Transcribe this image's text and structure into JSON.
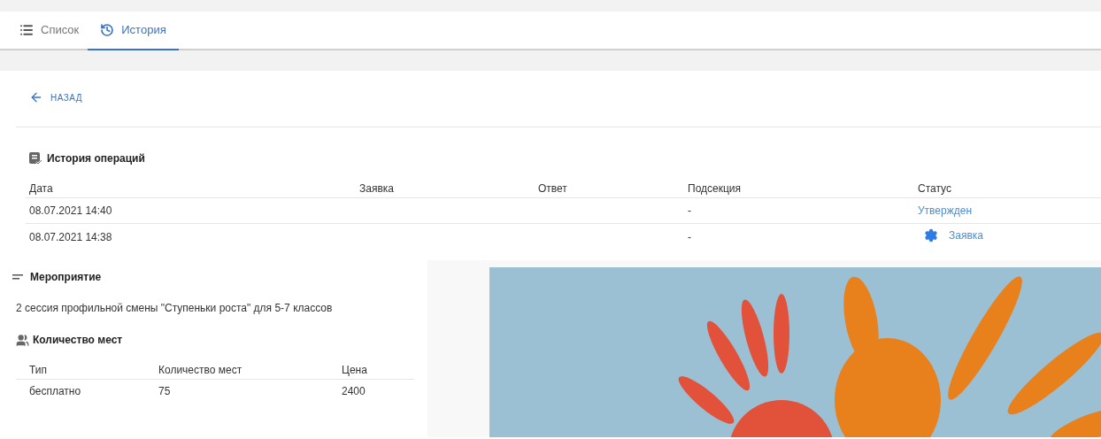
{
  "tabs": [
    {
      "label": "Список",
      "kind": "list",
      "selected": false
    },
    {
      "label": "История",
      "kind": "history",
      "selected": true
    }
  ],
  "back_link": "НАЗАД",
  "history": {
    "title": "История операций",
    "columns": [
      "Дата",
      "Заявка",
      "Ответ",
      "Подсекция",
      "Статус"
    ],
    "rows": [
      {
        "date": "08.07.2021 14:40",
        "subsection": "-",
        "status": {
          "kind": "link",
          "text": "Утвержден"
        }
      },
      {
        "date": "08.07.2021 14:38",
        "subsection": "-",
        "status": {
          "kind": "gear-link",
          "text": "Заявка"
        }
      }
    ]
  },
  "event": {
    "title": "Мероприятие",
    "description": "2 сессия профильной смены \"Ступеньки роста\" для 5-7 классов"
  },
  "places": {
    "title": "Количество мест",
    "columns": [
      "Тип",
      "Количество мест",
      "Цена"
    ],
    "rows": [
      [
        "бесплатно",
        "75",
        "2400"
      ]
    ]
  }
}
